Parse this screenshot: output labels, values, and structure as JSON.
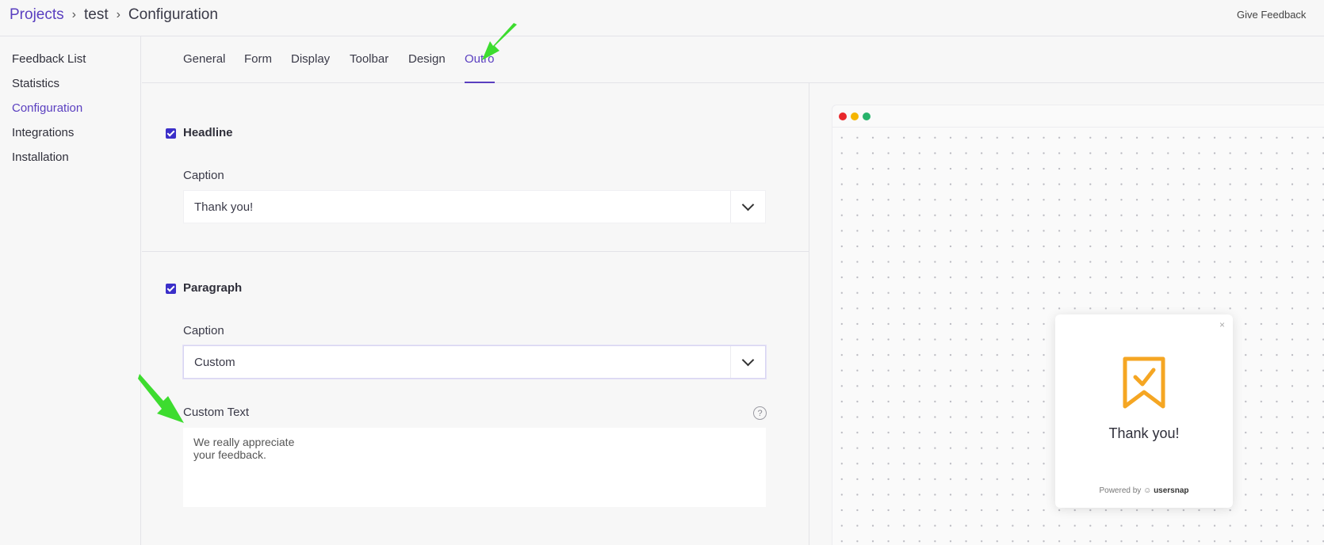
{
  "header": {
    "breadcrumb": [
      "Projects",
      "test",
      "Configuration"
    ],
    "give_feedback": "Give Feedback"
  },
  "sidebar": {
    "items": [
      {
        "label": "Feedback List"
      },
      {
        "label": "Statistics"
      },
      {
        "label": "Configuration",
        "active": true
      },
      {
        "label": "Integrations"
      },
      {
        "label": "Installation"
      }
    ]
  },
  "tabs": [
    {
      "label": "General"
    },
    {
      "label": "Form"
    },
    {
      "label": "Display"
    },
    {
      "label": "Toolbar"
    },
    {
      "label": "Design"
    },
    {
      "label": "Outro",
      "active": true
    }
  ],
  "headline": {
    "checked": true,
    "label": "Headline",
    "caption_label": "Caption",
    "caption_value": "Thank you!"
  },
  "paragraph": {
    "checked": true,
    "label": "Paragraph",
    "caption_label": "Caption",
    "caption_value": "Custom",
    "custom_text_label": "Custom Text",
    "custom_text_value": "We really appreciate\nyour feedback.",
    "help_glyph": "?"
  },
  "preview": {
    "close_glyph": "×",
    "title": "Thank you!",
    "powered_by": "Powered by",
    "brand": "usersnap",
    "icon": "bookmark-check-icon"
  },
  "colors": {
    "accent": "#5a3fc0",
    "checkbox": "#3b2fc9",
    "widget_icon": "#f5a623",
    "arrow": "#3ddc2f"
  }
}
